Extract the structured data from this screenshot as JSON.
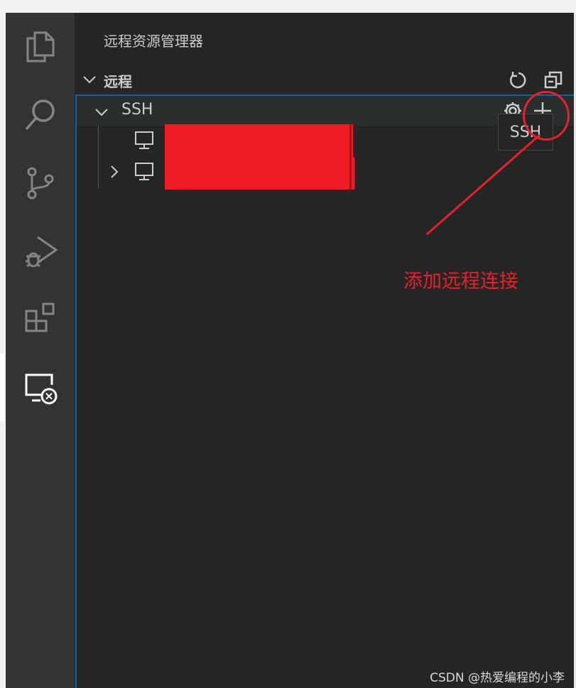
{
  "activity_bar": {
    "items": [
      {
        "icon": "files-icon"
      },
      {
        "icon": "search-icon"
      },
      {
        "icon": "source-control-icon"
      },
      {
        "icon": "run-debug-icon"
      },
      {
        "icon": "extensions-icon"
      },
      {
        "icon": "remote-explorer-icon",
        "active": true
      }
    ]
  },
  "sidebar": {
    "panel_title": "远程资源管理器",
    "section": {
      "title": "远程",
      "refresh_icon": "refresh-icon",
      "collapse_icon": "collapse-all-icon"
    },
    "tree": {
      "group_label": "SSH",
      "settings_icon": "gear-icon",
      "add_icon": "plus-icon",
      "hosts": [
        {
          "icon": "monitor-icon",
          "expandable": false,
          "redacted": true
        },
        {
          "icon": "monitor-icon",
          "expandable": true,
          "redacted": true
        }
      ]
    }
  },
  "tooltip": {
    "text": "SSH"
  },
  "annotation": {
    "text": "添加远程连接",
    "color": "#e3222a"
  },
  "watermark": "CSDN @热爱编程的小李",
  "colors": {
    "activity_bar": "#333333",
    "sidebar": "#252526",
    "focus_border": "#0e639c",
    "redaction": "#ed1c24"
  }
}
